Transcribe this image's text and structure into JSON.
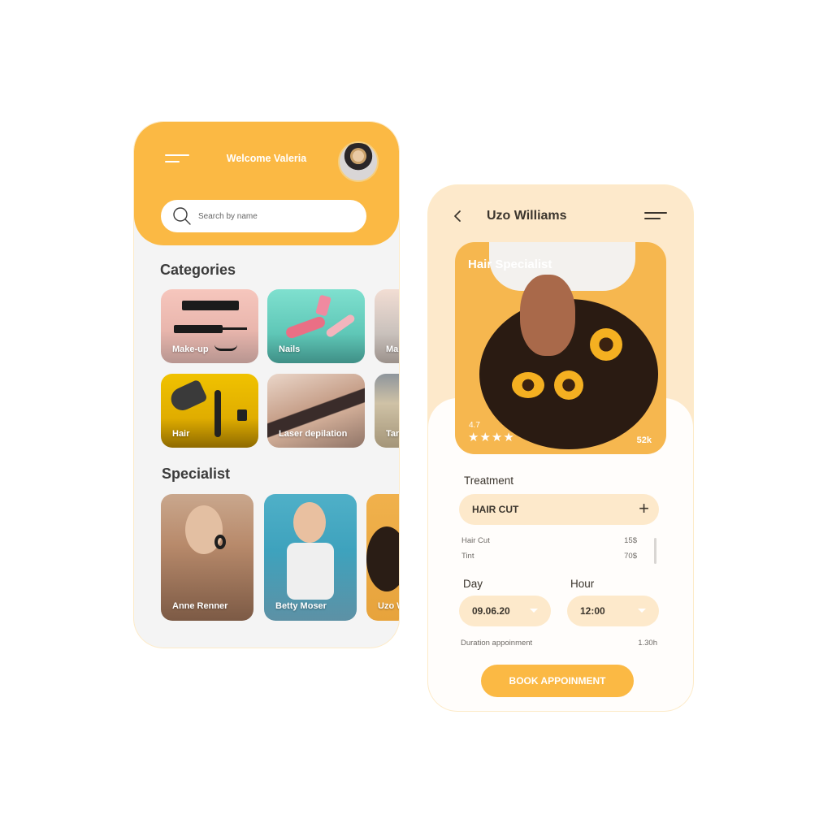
{
  "home": {
    "welcome": "Welcome Valeria",
    "search_placeholder": "Search by name",
    "categories_title": "Categories",
    "categories": [
      {
        "label": "Make-up"
      },
      {
        "label": "Nails"
      },
      {
        "label": "Ma"
      },
      {
        "label": "Hair"
      },
      {
        "label": "Laser depilation"
      },
      {
        "label": "Tan"
      }
    ],
    "specialist_title": "Specialist",
    "specialists": [
      {
        "name": "Anne Renner"
      },
      {
        "name": "Betty Moser"
      },
      {
        "name": "Uzo W"
      }
    ]
  },
  "detail": {
    "title": "Uzo Williams",
    "hero_title": "Hair Specialist",
    "rating": "4.7",
    "stars": "★★★★",
    "rating_value": 4,
    "reviews_count": "52k",
    "treatment_label": "Treatment",
    "treatment_selected": "HAIR CUT",
    "add_symbol": "+",
    "treatments": [
      {
        "name": "Hair Cut",
        "price": "15$"
      },
      {
        "name": "Tint",
        "price": "70$"
      }
    ],
    "day_label": "Day",
    "day_value": "09.06.20",
    "hour_label": "Hour",
    "hour_value": "12:00",
    "duration_label": "Duration appoinment",
    "duration_value": "1.30h",
    "book_button": "BOOK APPOINMENT"
  },
  "colors": {
    "accent": "#fbb944",
    "peach": "#fde9cb",
    "background": "#f4f4f4",
    "text_dark": "#3b352d"
  }
}
